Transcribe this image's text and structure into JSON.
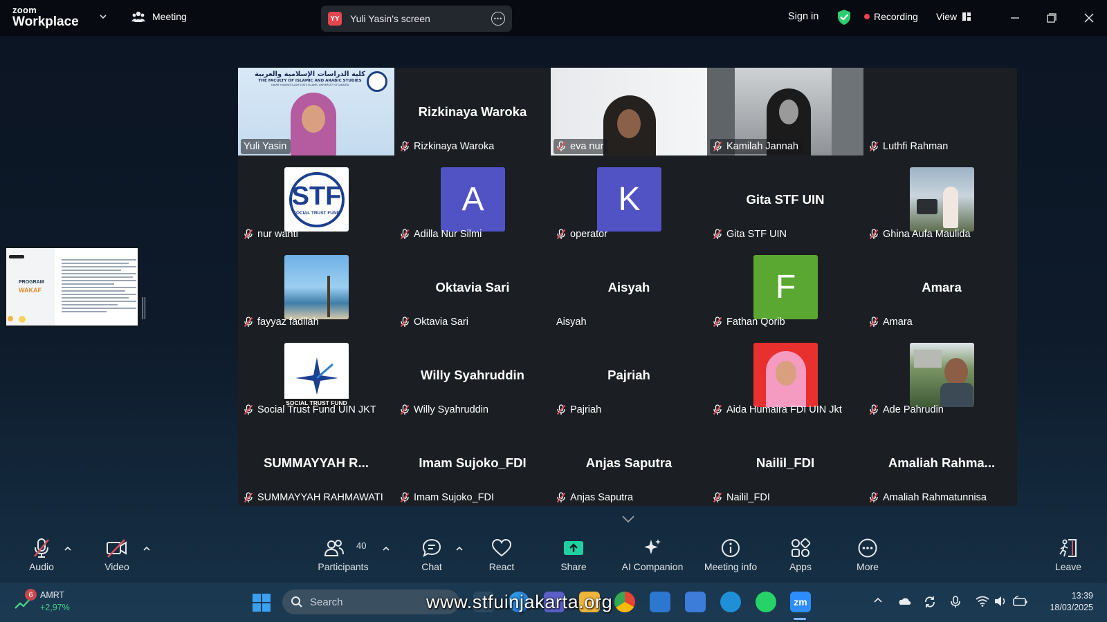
{
  "title_bar": {
    "brand_small": "zoom",
    "brand_big": "Workplace",
    "meeting_label": "Meeting",
    "share_badge": "YY",
    "share_text": "Yuli Yasin's screen",
    "sign_in": "Sign in",
    "recording": "Recording",
    "view": "View",
    "colors": {
      "recording_dot": "#e8424a",
      "shield": "#2ecc71"
    }
  },
  "shared_screen_thumbnail": {
    "title": "PROGRAM",
    "subtitle": "WAKAF"
  },
  "gallery": [
    {
      "display": "video",
      "name": "Yuli Yasin",
      "speaking": true,
      "mic_muted": false,
      "banner_arabic": "كلية الدراسات الإسلامية والعربية",
      "banner_english": "THE FACULTY OF ISLAMIC AND ARABIC STUDIES",
      "banner_sub": "SYARIF HIDAYATULLAH STATE ISLAMIC UNIVERSITY OF JAKARTA"
    },
    {
      "display": "name",
      "big_name": "Rizkinaya Waroka",
      "name": "Rizkinaya Waroka",
      "mic_muted": true
    },
    {
      "display": "video",
      "name": "eva nur",
      "mic_muted": true
    },
    {
      "display": "video",
      "name": "Kamilah Jannah",
      "mic_muted": true
    },
    {
      "display": "blank",
      "name": "Luthfi Rahman",
      "mic_muted": true
    },
    {
      "display": "logo",
      "logo_text": "STF",
      "logo_sub": "SOCIAL TRUST FUND",
      "name": "nur wanti",
      "mic_muted": true
    },
    {
      "display": "letter",
      "letter": "A",
      "name": "Adilla Nur Silmi",
      "mic_muted": true,
      "color": "#5153c4"
    },
    {
      "display": "letter",
      "letter": "K",
      "name": "operator",
      "mic_muted": true,
      "color": "#5153c4"
    },
    {
      "display": "name",
      "big_name": "Gita STF UIN",
      "name": "Gita STF UIN",
      "mic_muted": true
    },
    {
      "display": "photo",
      "name": "Ghina Aufa Maulida",
      "mic_muted": true
    },
    {
      "display": "photo",
      "name": "fayyaz fadilah",
      "mic_muted": true
    },
    {
      "display": "name",
      "big_name": "Oktavia Sari",
      "name": "Oktavia Sari",
      "mic_muted": true
    },
    {
      "display": "name",
      "big_name": "Aisyah",
      "name": "Aisyah",
      "mic_muted": false
    },
    {
      "display": "letter",
      "letter": "F",
      "name": "Fathan Qorib",
      "mic_muted": true,
      "color": "#5aa832"
    },
    {
      "display": "name",
      "big_name": "Amara",
      "name": "Amara",
      "mic_muted": true
    },
    {
      "display": "logo2",
      "logo_sub": "SOCIAL TRUST FUND",
      "name": "Social Trust Fund UIN JKT",
      "mic_muted": true
    },
    {
      "display": "name",
      "big_name": "Willy Syahruddin",
      "name": "Willy Syahruddin",
      "mic_muted": true
    },
    {
      "display": "name",
      "big_name": "Pajriah",
      "name": "Pajriah",
      "mic_muted": true
    },
    {
      "display": "photo",
      "name": "Aida Humaira FDI UIN Jkt",
      "mic_muted": true
    },
    {
      "display": "photo",
      "name": "Ade Pahrudin",
      "mic_muted": true
    },
    {
      "display": "name",
      "big_name": "SUMMAYYAH R...",
      "name": "SUMMAYYAH RAHMAWATI",
      "mic_muted": true
    },
    {
      "display": "name",
      "big_name": "Imam Sujoko_FDI",
      "name": "Imam Sujoko_FDI",
      "mic_muted": true
    },
    {
      "display": "name",
      "big_name": "Anjas Saputra",
      "name": "Anjas Saputra",
      "mic_muted": true
    },
    {
      "display": "name",
      "big_name": "Nailil_FDI",
      "name": "Nailil_FDI",
      "mic_muted": true
    },
    {
      "display": "name",
      "big_name": "Amaliah Rahma...",
      "name": "Amaliah Rahmatunnisa",
      "mic_muted": true
    }
  ],
  "toolbar": {
    "audio": "Audio",
    "video": "Video",
    "participants": "Participants",
    "participants_count": "40",
    "chat": "Chat",
    "react": "React",
    "share": "Share",
    "ai_companion": "AI Companion",
    "meeting_info": "Meeting info",
    "apps": "Apps",
    "more": "More",
    "leave": "Leave",
    "colors": {
      "share_icon": "#1fd1a1",
      "muted_slash": "#e0515b"
    }
  },
  "taskbar": {
    "weather_badge": "6",
    "ticker": "AMRT",
    "ticker_change": "+2,97%",
    "search_placeholder": "Search",
    "website_overlay": "www.stfuinjakarta.org",
    "zoom_icon_label": "zm",
    "time": "13:39",
    "date": "18/03/2025"
  }
}
